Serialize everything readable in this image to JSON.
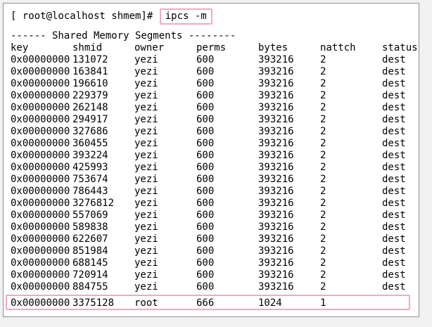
{
  "prompt": {
    "text": "[ root@localhost shmem]#",
    "command": "ipcs -m"
  },
  "title": "------ Shared Memory Segments --------",
  "columns": [
    "key",
    "shmid",
    "owner",
    "perms",
    "bytes",
    "nattch",
    "status"
  ],
  "rows": [
    [
      "0x00000000",
      "131072",
      "yezi",
      "600",
      "393216",
      "2",
      "dest"
    ],
    [
      "0x00000000",
      "163841",
      "yezi",
      "600",
      "393216",
      "2",
      "dest"
    ],
    [
      "0x00000000",
      "196610",
      "yezi",
      "600",
      "393216",
      "2",
      "dest"
    ],
    [
      "0x00000000",
      "229379",
      "yezi",
      "600",
      "393216",
      "2",
      "dest"
    ],
    [
      "0x00000000",
      "262148",
      "yezi",
      "600",
      "393216",
      "2",
      "dest"
    ],
    [
      "0x00000000",
      "294917",
      "yezi",
      "600",
      "393216",
      "2",
      "dest"
    ],
    [
      "0x00000000",
      "327686",
      "yezi",
      "600",
      "393216",
      "2",
      "dest"
    ],
    [
      "0x00000000",
      "360455",
      "yezi",
      "600",
      "393216",
      "2",
      "dest"
    ],
    [
      "0x00000000",
      "393224",
      "yezi",
      "600",
      "393216",
      "2",
      "dest"
    ],
    [
      "0x00000000",
      "425993",
      "yezi",
      "600",
      "393216",
      "2",
      "dest"
    ],
    [
      "0x00000000",
      "753674",
      "yezi",
      "600",
      "393216",
      "2",
      "dest"
    ],
    [
      "0x00000000",
      "786443",
      "yezi",
      "600",
      "393216",
      "2",
      "dest"
    ],
    [
      "0x00000000",
      "3276812",
      "yezi",
      "600",
      "393216",
      "2",
      "dest"
    ],
    [
      "0x00000000",
      "557069",
      "yezi",
      "600",
      "393216",
      "2",
      "dest"
    ],
    [
      "0x00000000",
      "589838",
      "yezi",
      "600",
      "393216",
      "2",
      "dest"
    ],
    [
      "0x00000000",
      "622607",
      "yezi",
      "600",
      "393216",
      "2",
      "dest"
    ],
    [
      "0x00000000",
      "851984",
      "yezi",
      "600",
      "393216",
      "2",
      "dest"
    ],
    [
      "0x00000000",
      "688145",
      "yezi",
      "600",
      "393216",
      "2",
      "dest"
    ],
    [
      "0x00000000",
      "720914",
      "yezi",
      "600",
      "393216",
      "2",
      "dest"
    ],
    [
      "0x00000000",
      "884755",
      "yezi",
      "600",
      "393216",
      "2",
      "dest"
    ],
    [
      "0x00000000",
      "3375128",
      "root",
      "666",
      "1024",
      "1",
      ""
    ]
  ],
  "highlight_color": "#f2a9c7"
}
